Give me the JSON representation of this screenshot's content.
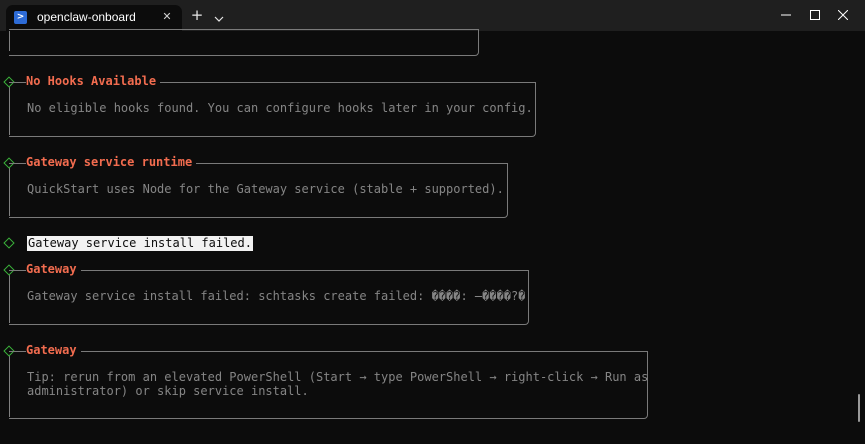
{
  "window": {
    "tab_title": "openclaw-onboard",
    "tab_icon": "powershell-icon"
  },
  "colors": {
    "background": "#0c0c0c",
    "titlebar": "#1f1f1f",
    "heading_accent": "#f26c4f",
    "bullet_green": "#3bb33b",
    "body_text": "#858585"
  },
  "sections": [
    {
      "title": "No Hooks Available",
      "lines": [
        "No eligible hooks found. You can configure hooks later in your config."
      ]
    },
    {
      "title": "Gateway service runtime",
      "lines": [
        "QuickStart uses Node for the Gateway service (stable + supported)."
      ]
    },
    {
      "title": "Gateway",
      "lines": [
        "Gateway service install failed: schtasks create failed: ����: ̶����?�"
      ]
    },
    {
      "title": "Gateway",
      "lines": [
        "Tip: rerun from an elevated PowerShell (Start → type PowerShell → right-click → Run as",
        "administrator) or skip service install."
      ]
    }
  ],
  "error_line": "Gateway service install failed."
}
